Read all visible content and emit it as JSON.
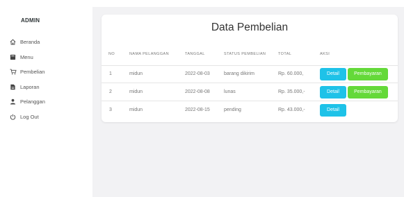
{
  "sidebar": {
    "brand": "ADMIN",
    "items": [
      {
        "label": "Beranda",
        "icon": "home-icon"
      },
      {
        "label": "Menu",
        "icon": "menu-book-icon"
      },
      {
        "label": "Pembelian",
        "icon": "cart-icon"
      },
      {
        "label": "Laporan",
        "icon": "report-file-icon"
      },
      {
        "label": "Pelanggan",
        "icon": "user-icon"
      },
      {
        "label": "Log Out",
        "icon": "power-icon"
      }
    ]
  },
  "main": {
    "title": "Data Pembelian",
    "columns": [
      "NO",
      "NAMA PELANGGAN",
      "TANGGAL",
      "STATUS PEMBELIAN",
      "TOTAL",
      "AKSI"
    ],
    "rows": [
      {
        "no": "1",
        "nama": "midun",
        "tanggal": "2022-08-03",
        "status": "barang dikirim",
        "total": "Rp. 60.000,",
        "detail": "Detail",
        "bayar": "Pembayaran"
      },
      {
        "no": "2",
        "nama": "midun",
        "tanggal": "2022-08-08",
        "status": "lunas",
        "total": "Rp. 35.000,-",
        "detail": "Detail",
        "bayar": "Pembayaran"
      },
      {
        "no": "3",
        "nama": "midun",
        "tanggal": "2022-08-15",
        "status": "pending",
        "total": "Rp. 43.000,-",
        "detail": "Detail"
      }
    ]
  },
  "colors": {
    "detail_button": "#1ec2e8",
    "payment_button": "#64d939",
    "content_background": "#f2f2f4"
  }
}
